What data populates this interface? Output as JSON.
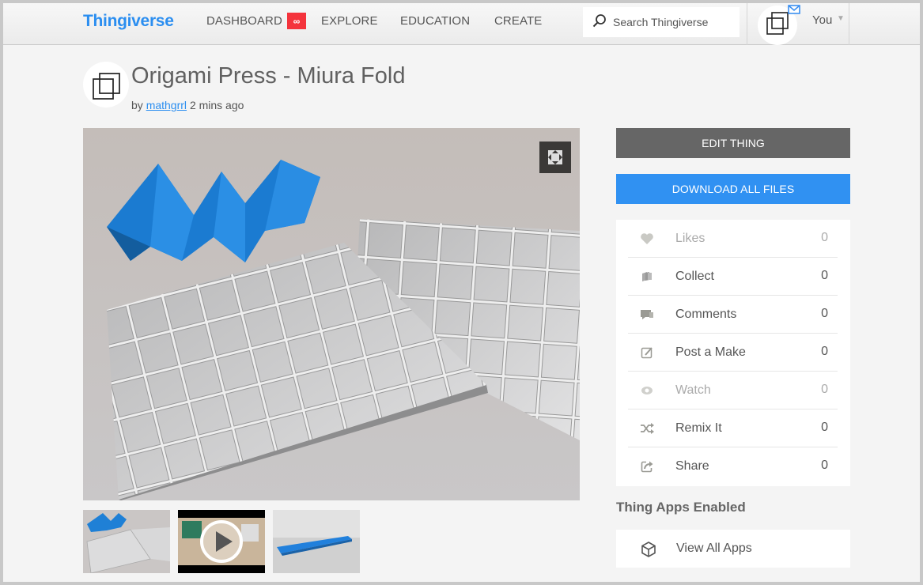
{
  "header": {
    "logo": "Thingiverse",
    "nav": {
      "dashboard": "DASHBOARD",
      "dashboard_badge": "∞",
      "explore": "EXPLORE",
      "education": "EDUCATION",
      "create": "CREATE"
    },
    "search_placeholder": "Search Thingiverse",
    "user_label": "You"
  },
  "thing": {
    "title": "Origami Press - Miura Fold",
    "by_prefix": "by",
    "author": "mathgrrl",
    "time_ago": "2 mins ago"
  },
  "actions": {
    "edit": "EDIT THING",
    "download": "DOWNLOAD ALL FILES"
  },
  "stats": [
    {
      "label": "Likes",
      "count": "0",
      "icon": "heart-icon",
      "muted": true
    },
    {
      "label": "Collect",
      "count": "0",
      "icon": "collect-icon",
      "muted": false
    },
    {
      "label": "Comments",
      "count": "0",
      "icon": "comments-icon",
      "muted": false
    },
    {
      "label": "Post a Make",
      "count": "0",
      "icon": "edit-icon",
      "muted": false
    },
    {
      "label": "Watch",
      "count": "0",
      "icon": "eye-icon",
      "muted": true
    },
    {
      "label": "Remix It",
      "count": "0",
      "icon": "shuffle-icon",
      "muted": false
    },
    {
      "label": "Share",
      "count": "0",
      "icon": "share-icon",
      "muted": false
    }
  ],
  "apps": {
    "heading": "Thing Apps Enabled",
    "view_all": "View All Apps"
  },
  "colors": {
    "brand_blue": "#2b8ef0",
    "download_blue": "#3091f2",
    "edit_gray": "#666666",
    "badge_red": "#f4333c"
  }
}
